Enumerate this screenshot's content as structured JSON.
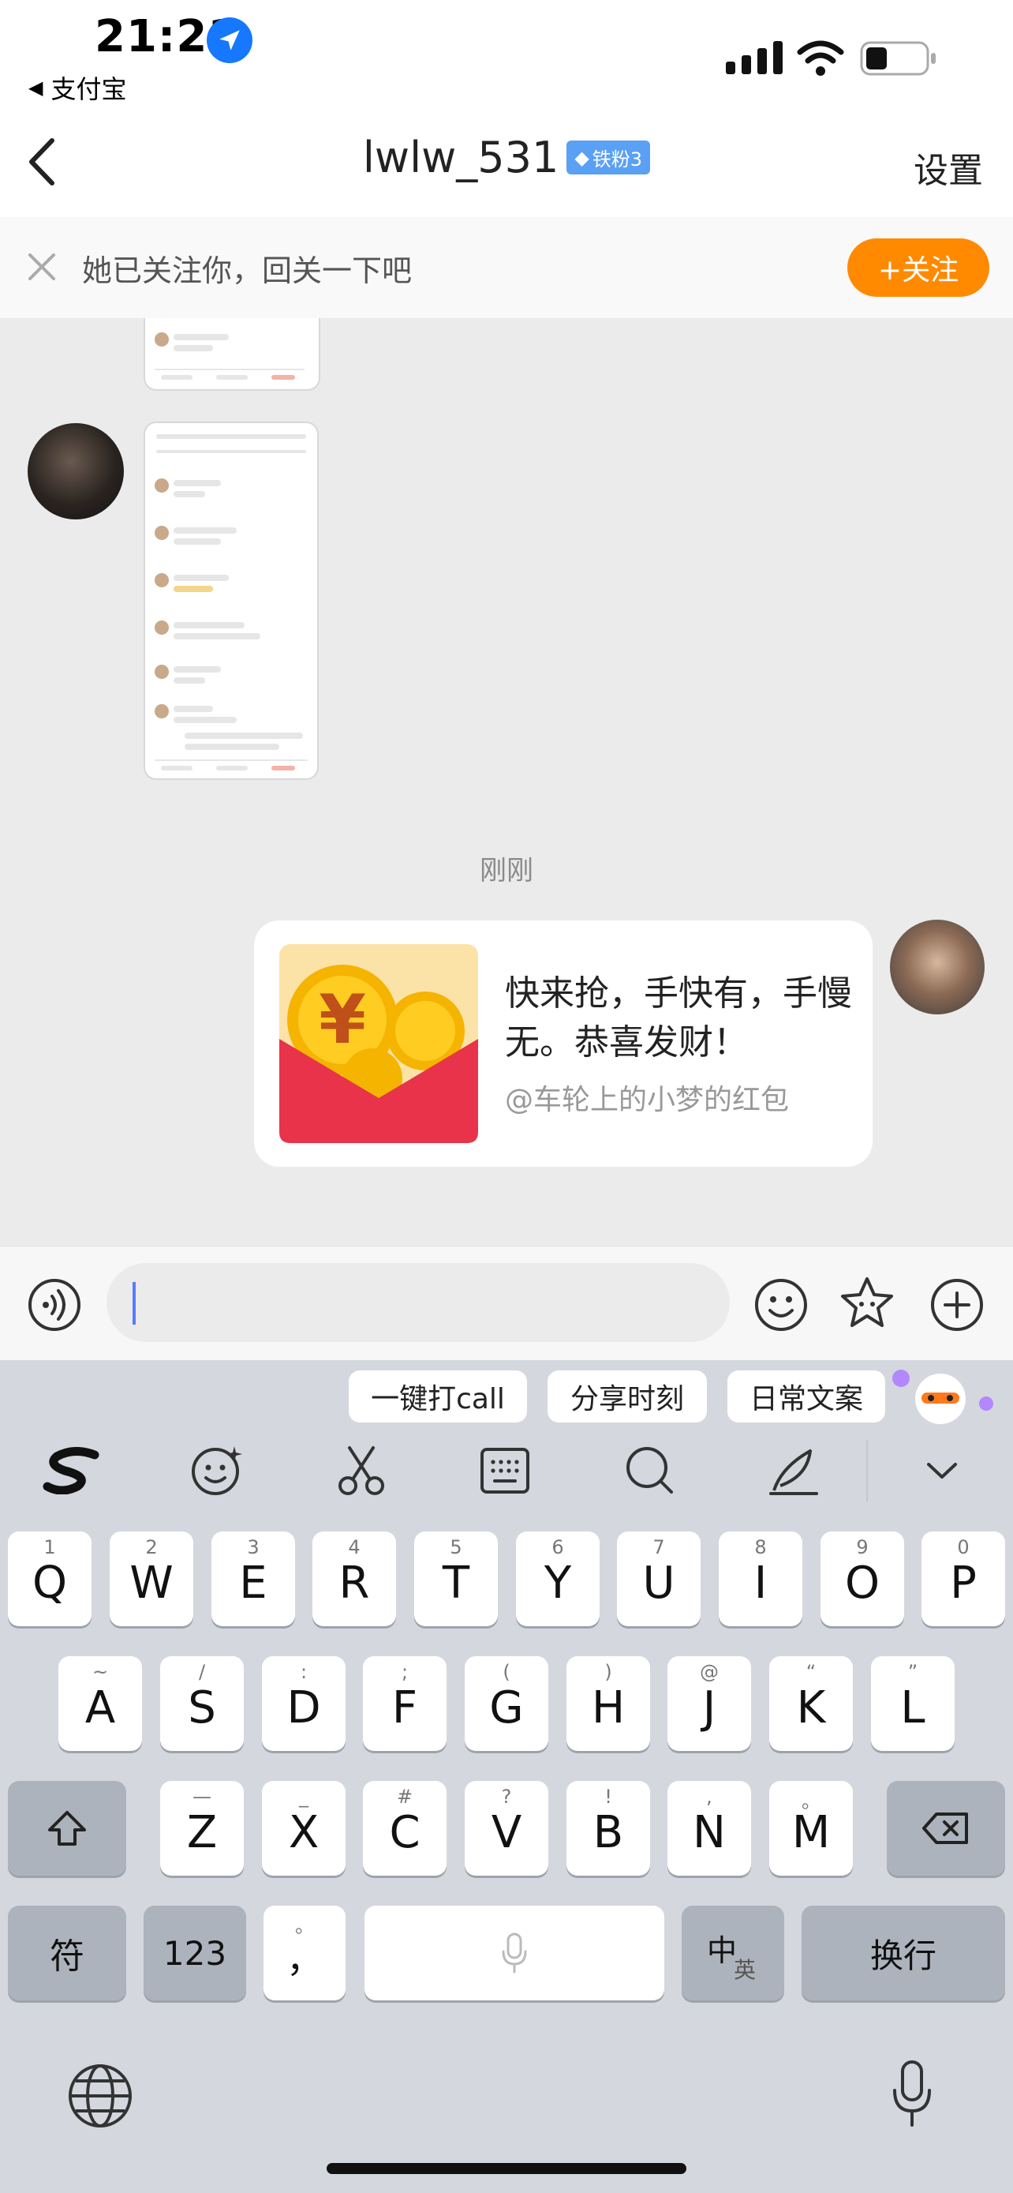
{
  "status_bar": {
    "time": "21:21",
    "back_app": "支付宝"
  },
  "nav": {
    "title": "lwlw_531",
    "fan_badge": "铁粉3",
    "settings": "设置"
  },
  "follow_banner": {
    "text": "她已关注你，回关一下吧",
    "button": "+关注"
  },
  "chat": {
    "timestamp": "刚刚",
    "red_packet": {
      "message": "快来抢，手快有，手慢无。恭喜发财！",
      "sender": "@车轮上的小梦的红包"
    }
  },
  "input": {
    "placeholder": ""
  },
  "keyboard": {
    "suggestions": [
      "一键打call",
      "分享时刻",
      "日常文案"
    ],
    "row1": [
      {
        "key": "Q",
        "sub": "1"
      },
      {
        "key": "W",
        "sub": "2"
      },
      {
        "key": "E",
        "sub": "3"
      },
      {
        "key": "R",
        "sub": "4"
      },
      {
        "key": "T",
        "sub": "5"
      },
      {
        "key": "Y",
        "sub": "6"
      },
      {
        "key": "U",
        "sub": "7"
      },
      {
        "key": "I",
        "sub": "8"
      },
      {
        "key": "O",
        "sub": "9"
      },
      {
        "key": "P",
        "sub": "0"
      }
    ],
    "row2": [
      {
        "key": "A",
        "sub": "~"
      },
      {
        "key": "S",
        "sub": "/"
      },
      {
        "key": "D",
        "sub": ":"
      },
      {
        "key": "F",
        "sub": ";"
      },
      {
        "key": "G",
        "sub": "("
      },
      {
        "key": "H",
        "sub": ")"
      },
      {
        "key": "J",
        "sub": "@"
      },
      {
        "key": "K",
        "sub": "“"
      },
      {
        "key": "L",
        "sub": "”"
      }
    ],
    "row3": [
      {
        "key": "Z",
        "sub": "—"
      },
      {
        "key": "X",
        "sub": "_"
      },
      {
        "key": "C",
        "sub": "#"
      },
      {
        "key": "V",
        "sub": "?"
      },
      {
        "key": "B",
        "sub": "!"
      },
      {
        "key": "N",
        "sub": ","
      },
      {
        "key": "M",
        "sub": "。"
      }
    ],
    "symbol_key": "符",
    "num_key": "123",
    "punct_key": "，",
    "punct_sub": "。",
    "lang_key_main": "中",
    "lang_key_sub": "英",
    "return_key": "换行"
  },
  "colors": {
    "accent_orange": "#ff8a00",
    "fan_badge_blue": "#5aa0f5",
    "red_packet": "#e8334a"
  }
}
